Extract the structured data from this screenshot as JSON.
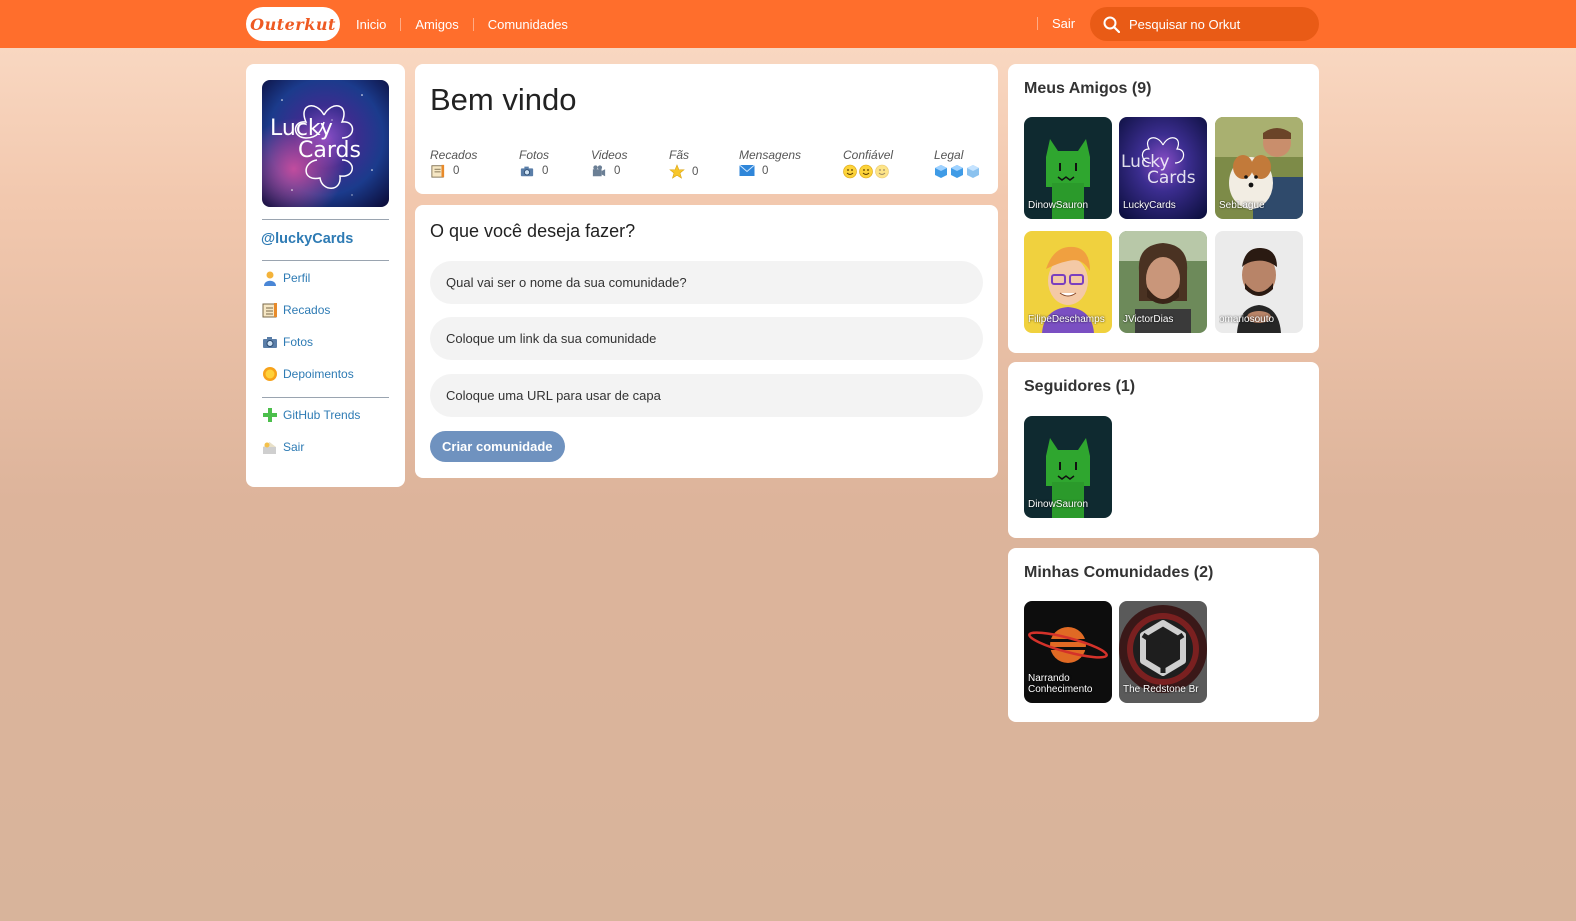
{
  "header": {
    "logo": "Outerkut",
    "nav": [
      "Inicio",
      "Amigos",
      "Comunidades"
    ],
    "logout": "Sair",
    "search_placeholder": "Pesquisar no Orkut"
  },
  "profile": {
    "avatar_text": [
      "Lucky",
      "Cards"
    ],
    "username": "@luckyCards",
    "menu": [
      {
        "label": "Perfil",
        "icon": "user-icon"
      },
      {
        "label": "Recados",
        "icon": "notebook-icon"
      },
      {
        "label": "Fotos",
        "icon": "camera-icon"
      },
      {
        "label": "Depoimentos",
        "icon": "sun-icon"
      }
    ],
    "menu2": [
      {
        "label": "GitHub Trends",
        "icon": "plus-icon"
      },
      {
        "label": "Sair",
        "icon": "logout-icon"
      }
    ]
  },
  "welcome": {
    "title": "Bem vindo",
    "stats": [
      {
        "label": "Recados",
        "value": "0",
        "icon": "notebook-icon"
      },
      {
        "label": "Fotos",
        "value": "0",
        "icon": "camera-icon"
      },
      {
        "label": "Videos",
        "value": "0",
        "icon": "video-camera-icon"
      },
      {
        "label": "Fãs",
        "value": "0",
        "icon": "star-icon"
      },
      {
        "label": "Mensagens",
        "value": "0",
        "icon": "envelope-icon"
      },
      {
        "label": "Confiável",
        "icon": "smiley-icon",
        "count": 3
      },
      {
        "label": "Legal",
        "icon": "ice-cube-icon",
        "count": 3
      }
    ]
  },
  "create": {
    "title": "O que você deseja fazer?",
    "fields": [
      "Qual vai ser o nome da sua comunidade?",
      "Coloque um link da sua comunidade",
      "Coloque uma URL para usar de capa"
    ],
    "button": "Criar comunidade"
  },
  "friends": {
    "title": "Meus Amigos (9)",
    "items": [
      "DinowSauron",
      "LuckyCards",
      "SebLague",
      "FilipeDeschamps",
      "JVictorDias",
      "omariosouto"
    ]
  },
  "followers": {
    "title": "Seguidores (1)",
    "items": [
      "DinowSauron"
    ]
  },
  "communities": {
    "title": "Minhas Comunidades (2)",
    "items": [
      "Narrando Conhecimento",
      "The Redstone Br"
    ]
  },
  "colors": {
    "topbar": "#ff6e2c",
    "search": "#e95b16",
    "link": "#2e7bb4",
    "button": "#6f92bf"
  }
}
